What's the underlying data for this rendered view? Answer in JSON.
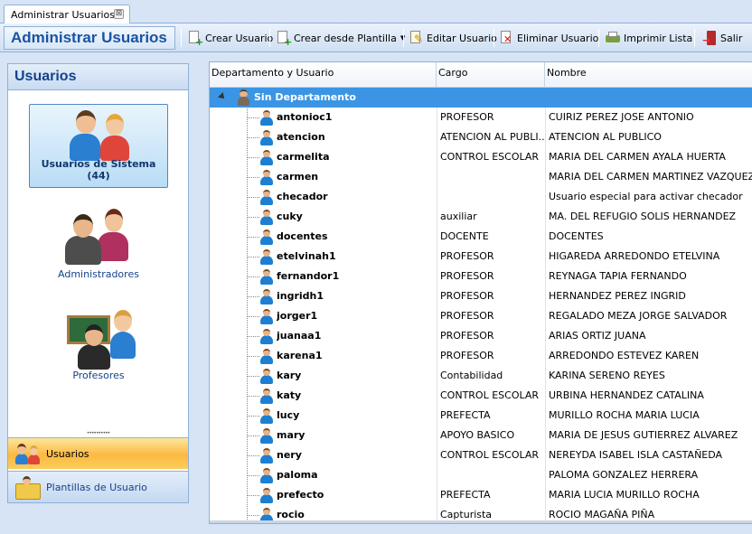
{
  "tab": {
    "title": "Administrar Usuarios",
    "close": "⊠"
  },
  "header": {
    "title": "Administrar Usuarios",
    "toolbar": [
      {
        "label": "Crear Usuario",
        "icon": "new-user-icon"
      },
      {
        "label": "Crear desde Plantilla",
        "icon": "new-from-template-icon",
        "dropdown": true
      },
      {
        "label": "Editar Usuario",
        "icon": "edit-icon"
      },
      {
        "label": "Eliminar Usuario",
        "icon": "delete-icon"
      },
      {
        "label": "Imprimir Lista",
        "icon": "print-icon"
      },
      {
        "label": "Salir",
        "icon": "exit-icon"
      }
    ]
  },
  "left_panel": {
    "title": "Usuarios",
    "items": [
      {
        "label": "Usuarios de Sistema (44)",
        "selected": true
      },
      {
        "label": "Administradores",
        "selected": false
      },
      {
        "label": "Profesores",
        "selected": false
      }
    ],
    "nav": [
      {
        "label": "Usuarios",
        "active": true
      },
      {
        "label": "Plantillas de Usuario",
        "active": false
      }
    ]
  },
  "grid": {
    "columns": [
      "Departamento y Usuario",
      "Cargo",
      "Nombre"
    ],
    "group": "Sin Departamento",
    "rows": [
      {
        "user": "antonioc1",
        "cargo": "PROFESOR",
        "nombre": "CUIRIZ PEREZ JOSE ANTONIO"
      },
      {
        "user": "atencion",
        "cargo": "ATENCION AL PUBLI...",
        "nombre": "ATENCION AL PUBLICO"
      },
      {
        "user": "carmelita",
        "cargo": "CONTROL ESCOLAR",
        "nombre": "MARIA DEL CARMEN AYALA HUERTA"
      },
      {
        "user": "carmen",
        "cargo": "",
        "nombre": "MARIA DEL CARMEN MARTINEZ VAZQUEZ"
      },
      {
        "user": "checador",
        "cargo": "",
        "nombre": "Usuario especial para activar checador"
      },
      {
        "user": "cuky",
        "cargo": "auxiliar",
        "nombre": "MA. DEL REFUGIO SOLIS HERNANDEZ"
      },
      {
        "user": "docentes",
        "cargo": "DOCENTE",
        "nombre": "DOCENTES"
      },
      {
        "user": "etelvinah1",
        "cargo": "PROFESOR",
        "nombre": "HIGAREDA ARREDONDO ETELVINA"
      },
      {
        "user": "fernandor1",
        "cargo": "PROFESOR",
        "nombre": "REYNAGA TAPIA FERNANDO"
      },
      {
        "user": "ingridh1",
        "cargo": "PROFESOR",
        "nombre": "HERNANDEZ PEREZ INGRID"
      },
      {
        "user": "jorger1",
        "cargo": "PROFESOR",
        "nombre": "REGALADO MEZA JORGE SALVADOR"
      },
      {
        "user": "juanaa1",
        "cargo": "PROFESOR",
        "nombre": "ARIAS ORTIZ JUANA"
      },
      {
        "user": "karena1",
        "cargo": "PROFESOR",
        "nombre": "ARREDONDO ESTEVEZ KAREN"
      },
      {
        "user": "kary",
        "cargo": "Contabilidad",
        "nombre": "KARINA SERENO REYES"
      },
      {
        "user": "katy",
        "cargo": "CONTROL ESCOLAR",
        "nombre": "URBINA HERNANDEZ CATALINA"
      },
      {
        "user": "lucy",
        "cargo": "PREFECTA",
        "nombre": "MURILLO ROCHA MARIA LUCIA"
      },
      {
        "user": "mary",
        "cargo": "APOYO BASICO",
        "nombre": "MARIA DE JESUS GUTIERREZ ALVAREZ"
      },
      {
        "user": "nery",
        "cargo": "CONTROL ESCOLAR",
        "nombre": "NEREYDA ISABEL ISLA CASTAÑEDA"
      },
      {
        "user": "paloma",
        "cargo": "",
        "nombre": "PALOMA GONZALEZ HERRERA"
      },
      {
        "user": "prefecto",
        "cargo": "PREFECTA",
        "nombre": "MARIA LUCIA MURILLO ROCHA"
      },
      {
        "user": "rocio",
        "cargo": "Capturista",
        "nombre": "ROCIO MAGAÑA PIÑA"
      }
    ]
  },
  "colors": {
    "accent": "#1a53a3",
    "selection": "#3b95e4",
    "nav_active": "#fbb942"
  }
}
